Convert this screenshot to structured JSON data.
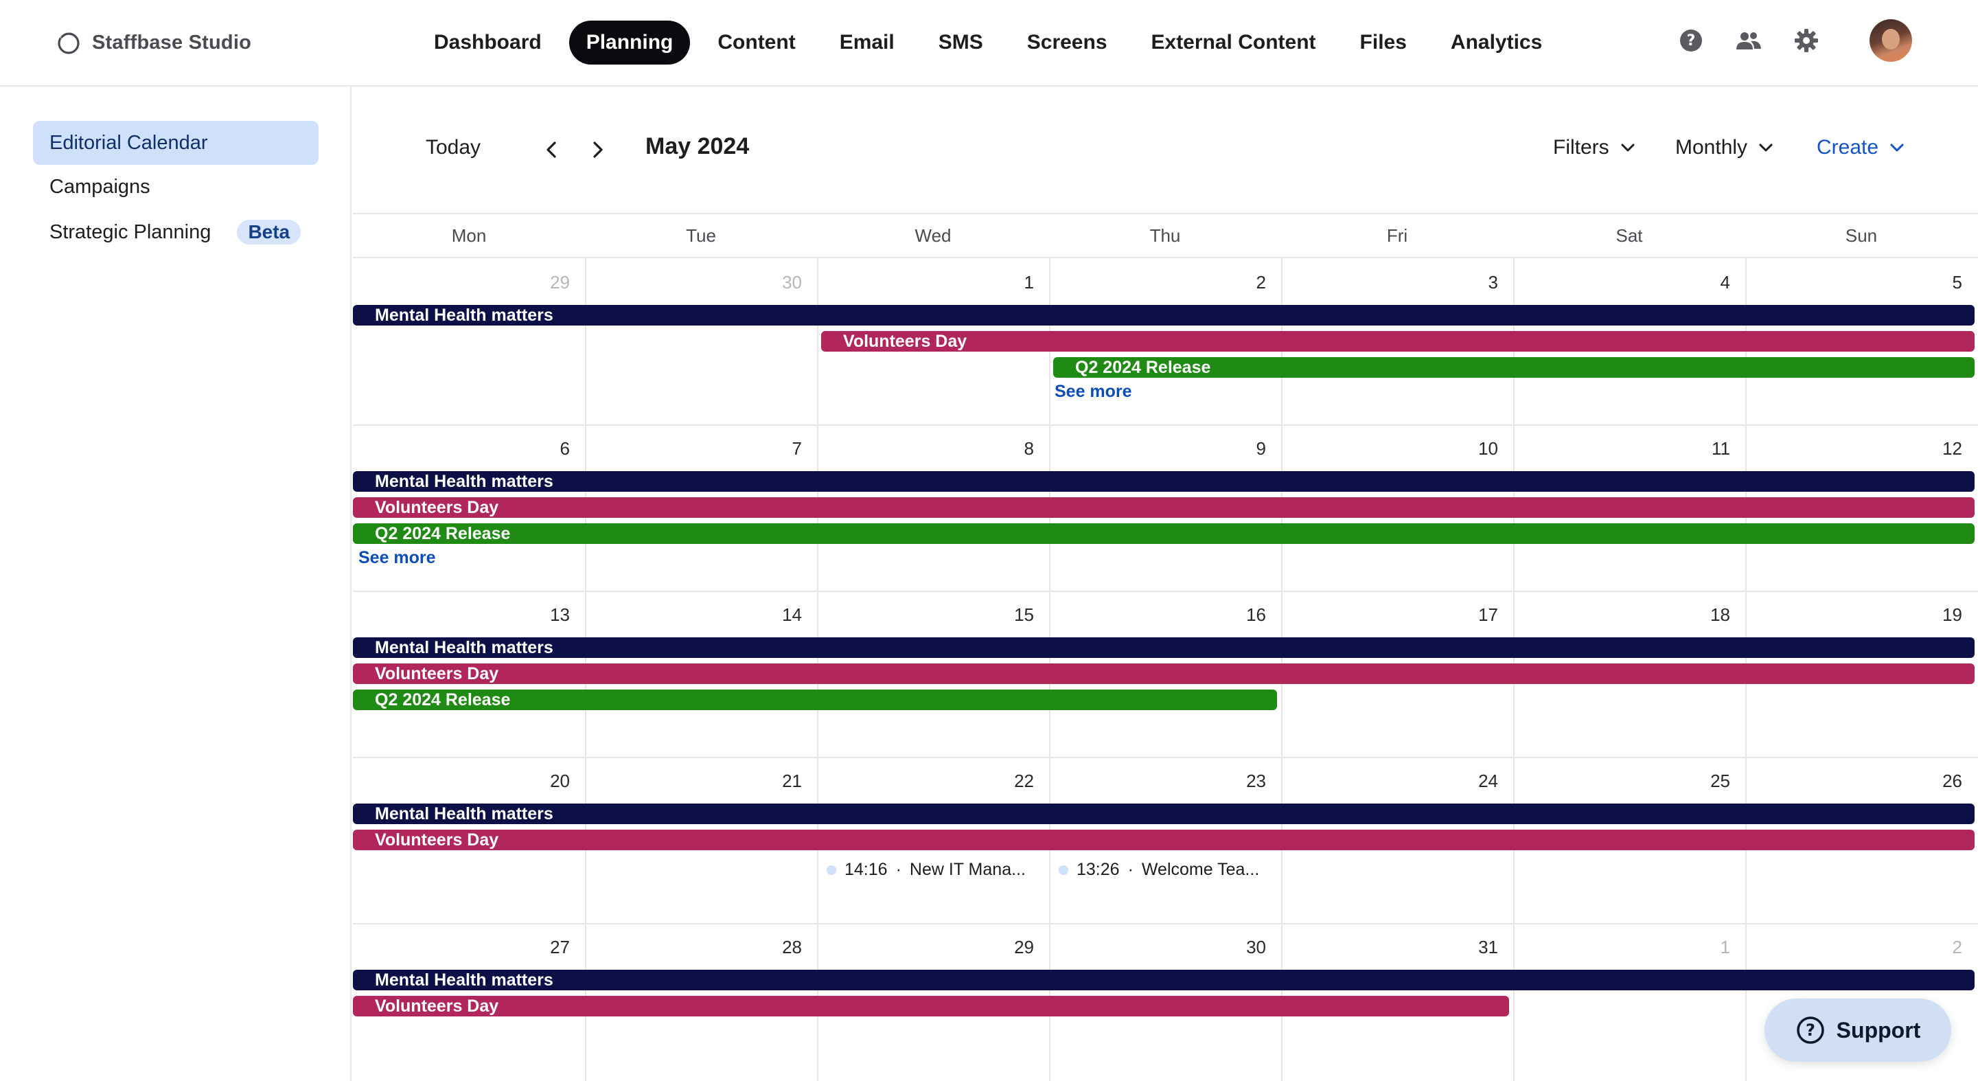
{
  "app": {
    "name": "Staffbase Studio"
  },
  "nav": {
    "items": [
      "Dashboard",
      "Planning",
      "Content",
      "Email",
      "SMS",
      "Screens",
      "External Content",
      "Files",
      "Analytics"
    ],
    "active": "Planning"
  },
  "top_icons": [
    "help-icon",
    "people-icon",
    "gear-icon",
    "avatar"
  ],
  "sidebar": {
    "items": [
      {
        "label": "Editorial Calendar",
        "active": true
      },
      {
        "label": "Campaigns"
      },
      {
        "label": "Strategic Planning",
        "badge": "Beta"
      }
    ]
  },
  "toolbar": {
    "today": "Today",
    "prev_icon": "chevron-left-icon",
    "next_icon": "chevron-right-icon",
    "month": "May 2024",
    "filters": "Filters",
    "view": "Monthly",
    "create": "Create"
  },
  "calendar": {
    "weekdays": [
      "Mon",
      "Tue",
      "Wed",
      "Thu",
      "Fri",
      "Sat",
      "Sun"
    ],
    "weeks": [
      {
        "days": [
          "29",
          "30",
          "1",
          "2",
          "3",
          "4",
          "5"
        ],
        "muted": [
          true,
          true,
          false,
          false,
          false,
          false,
          false
        ]
      },
      {
        "days": [
          "6",
          "7",
          "8",
          "9",
          "10",
          "11",
          "12"
        ],
        "muted": [
          false,
          false,
          false,
          false,
          false,
          false,
          false
        ]
      },
      {
        "days": [
          "13",
          "14",
          "15",
          "16",
          "17",
          "18",
          "19"
        ],
        "muted": [
          false,
          false,
          false,
          false,
          false,
          false,
          false
        ]
      },
      {
        "days": [
          "20",
          "21",
          "22",
          "23",
          "24",
          "25",
          "26"
        ],
        "muted": [
          false,
          false,
          false,
          false,
          false,
          false,
          false
        ]
      },
      {
        "days": [
          "27",
          "28",
          "29",
          "30",
          "31",
          "1",
          "2"
        ],
        "muted": [
          false,
          false,
          false,
          false,
          false,
          true,
          true
        ]
      }
    ],
    "campaigns": [
      {
        "label": "Mental Health matters",
        "color": "#0d0f47"
      },
      {
        "label": "Volunteers Day",
        "color": "#b2275a"
      },
      {
        "label": "Q2 2024 Release",
        "color": "#1f8a14"
      }
    ],
    "see_more": "See more",
    "events": [
      {
        "time": "14:16",
        "title": "New IT Mana...",
        "day": "22"
      },
      {
        "time": "13:26",
        "title": "Welcome Tea...",
        "day": "23"
      }
    ]
  },
  "support": {
    "label": "Support"
  }
}
